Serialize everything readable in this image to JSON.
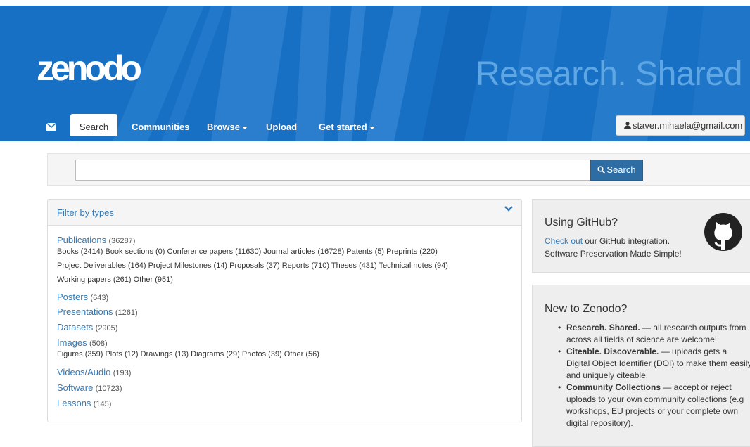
{
  "header": {
    "logo": "zenodo",
    "tagline": "Research. Shared",
    "colors": {
      "hero": "#1f7acd",
      "tagline": "#5fa7e4",
      "link": "#337ab7",
      "primary_button": "#2e6da4"
    }
  },
  "nav": {
    "mail_icon": "envelope-icon",
    "search": "Search",
    "communities": "Communities",
    "browse": "Browse",
    "upload": "Upload",
    "get_started": "Get started",
    "user": "staver.mihaela@gmail.com"
  },
  "search": {
    "value": "",
    "placeholder": "",
    "button": "Search"
  },
  "filter": {
    "title": "Filter by types",
    "publications": {
      "label": "Publications",
      "count": "(36287)"
    },
    "pub_sub": [
      "Books (2414) Book sections (0) Conference papers (11630) Journal articles (16728) Patents (5) Preprints (220)",
      "Project Deliverables (164) Project Milestones (14) Proposals (37) Reports (710) Theses (431) Technical notes (94)",
      "Working papers (261) Other (951)"
    ],
    "posters": {
      "label": "Posters",
      "count": "(643)"
    },
    "presentations": {
      "label": "Presentations",
      "count": "(1261)"
    },
    "datasets": {
      "label": "Datasets",
      "count": "(2905)"
    },
    "images": {
      "label": "Images",
      "count": "(508)"
    },
    "images_sub": "Figures (359) Plots (12) Drawings (13) Diagrams (29) Photos (39) Other (56)",
    "videos": {
      "label": "Videos/Audio",
      "count": "(193)"
    },
    "software": {
      "label": "Software",
      "count": "(10723)"
    },
    "lessons": {
      "label": "Lessons",
      "count": "(145)"
    }
  },
  "github": {
    "title": "Using GitHub?",
    "link": "Check out",
    "line1_rest": " our GitHub integration.",
    "line2": "Software Preservation Made Simple!"
  },
  "new_to_zenodo": {
    "title": "New to Zenodo?",
    "items": [
      {
        "bold": "Research. Shared.",
        "text": " — all research outputs from across all fields of science are welcome!"
      },
      {
        "bold": "Citeable. Discoverable.",
        "text": " — uploads gets a Digital Object Identifier (DOI) to make them easily and uniquely citeable."
      },
      {
        "bold": "Community Collections",
        "text": " — accept or reject uploads to your own community collections (e.g workshops, EU projects or your complete own digital repository)."
      }
    ]
  }
}
